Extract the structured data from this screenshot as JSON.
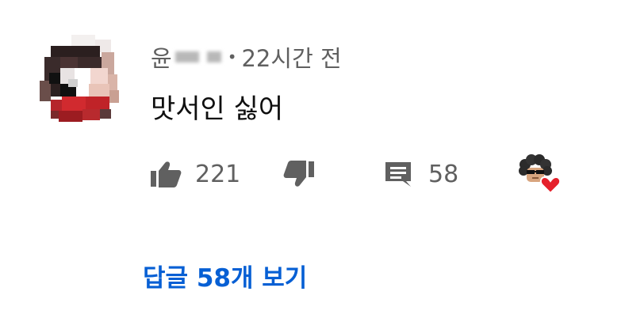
{
  "comment": {
    "author_prefix": "윤",
    "separator": "•",
    "time": "22시간 전",
    "text": "맛서인 싫어",
    "likes": "221",
    "replies": "58",
    "view_replies": "답글 58개 보기"
  },
  "icons": {
    "like": "thumbs-up-icon",
    "dislike": "thumbs-down-icon",
    "reply": "comment-icon",
    "creator_heart": "creator-heart-icon"
  },
  "colors": {
    "text_secondary": "#606060",
    "text_primary": "#0f0f0f",
    "link": "#065fd4",
    "heart": "#e5202b"
  }
}
